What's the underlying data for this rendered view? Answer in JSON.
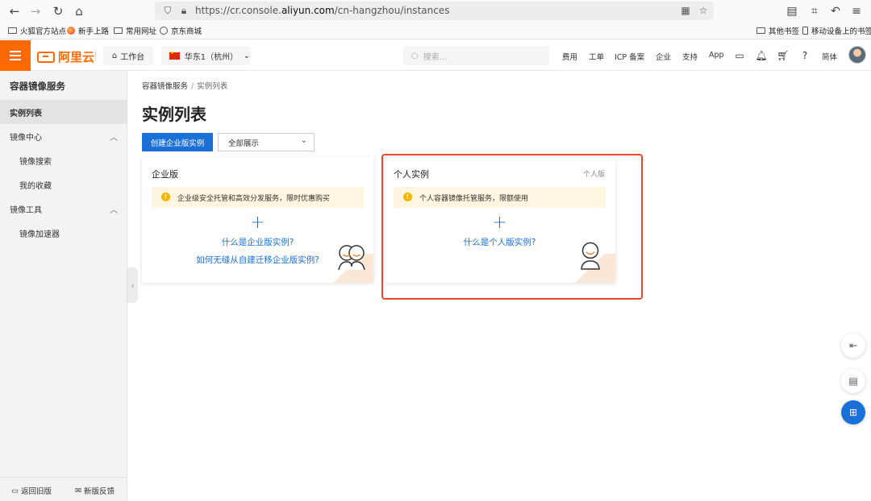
{
  "browser": {
    "url_prefix": "https://cr.console.",
    "url_domain": "aliyun.com",
    "url_path": "/cn-hangzhou/instances",
    "bookmarks": [
      "火狐官方站点",
      "新手上路",
      "常用网址",
      "京东商城"
    ],
    "bookmarks_right": [
      "其他书签",
      "移动设备上的书签"
    ]
  },
  "topbar": {
    "logo_text": "阿里云",
    "workbench": "工作台",
    "region": "华东1（杭州）",
    "search_placeholder": "搜索...",
    "nav": [
      "费用",
      "工单",
      "ICP 备案",
      "企业",
      "支持",
      "App"
    ],
    "lang": "简体"
  },
  "sidebar": {
    "title": "容器镜像服务",
    "items": [
      {
        "label": "实例列表"
      },
      {
        "label": "镜像中心"
      },
      {
        "label": "镜像搜索"
      },
      {
        "label": "我的收藏"
      },
      {
        "label": "镜像工具"
      },
      {
        "label": "镜像加速器"
      }
    ],
    "back_old": "返回旧版",
    "feedback": "新版反馈"
  },
  "main": {
    "breadcrumb": [
      "容器镜像服务",
      "实例列表"
    ],
    "breadcrumb_sep": "/",
    "title": "实例列表",
    "create_button": "创建企业版实例",
    "filter_value": "全部展示",
    "cards": [
      {
        "title": "企业版",
        "tag": "",
        "notice": "企业级安全托管和高效分发服务，限时优惠购买",
        "plus": "+",
        "links": [
          "什么是企业版实例?",
          "如何无缝从自建迁移企业版实例?"
        ]
      },
      {
        "title": "个人实例",
        "tag": "个人版",
        "notice": "个人容器镜像托管服务，限额使用",
        "plus": "+",
        "links": [
          "什么是个人版实例?"
        ]
      }
    ]
  }
}
